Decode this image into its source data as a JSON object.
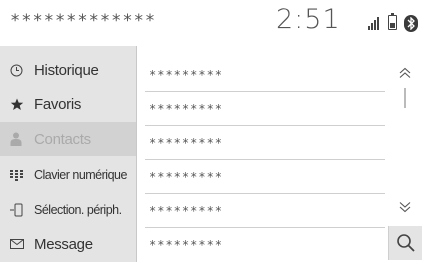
{
  "header": {
    "device_name": "*************",
    "clock": "2:51"
  },
  "icons": {
    "signal": "signal-strength-icon",
    "battery": "battery-icon",
    "bluetooth": "bluetooth-icon"
  },
  "sidebar": {
    "items": [
      {
        "label": "Historique",
        "icon": "clock-icon",
        "active": false
      },
      {
        "label": "Favoris",
        "icon": "star-icon",
        "active": false
      },
      {
        "label": "Contacts",
        "icon": "person-icon",
        "active": true
      },
      {
        "label": "Clavier numérique",
        "icon": "keypad-icon",
        "active": false
      },
      {
        "label": "Sélection. périph.",
        "icon": "device-icon",
        "active": false
      },
      {
        "label": "Message",
        "icon": "envelope-icon",
        "active": false
      }
    ]
  },
  "list": {
    "rows": [
      {
        "text": "*********"
      },
      {
        "text": "*********"
      },
      {
        "text": "*********"
      },
      {
        "text": "*********"
      },
      {
        "text": "*********"
      },
      {
        "text": "*********"
      }
    ]
  },
  "colors": {
    "sidebar_bg": "#e4e4e4",
    "active_bg": "#d2d2d2",
    "text": "#333333",
    "inactive_text": "#aaaaaa"
  }
}
